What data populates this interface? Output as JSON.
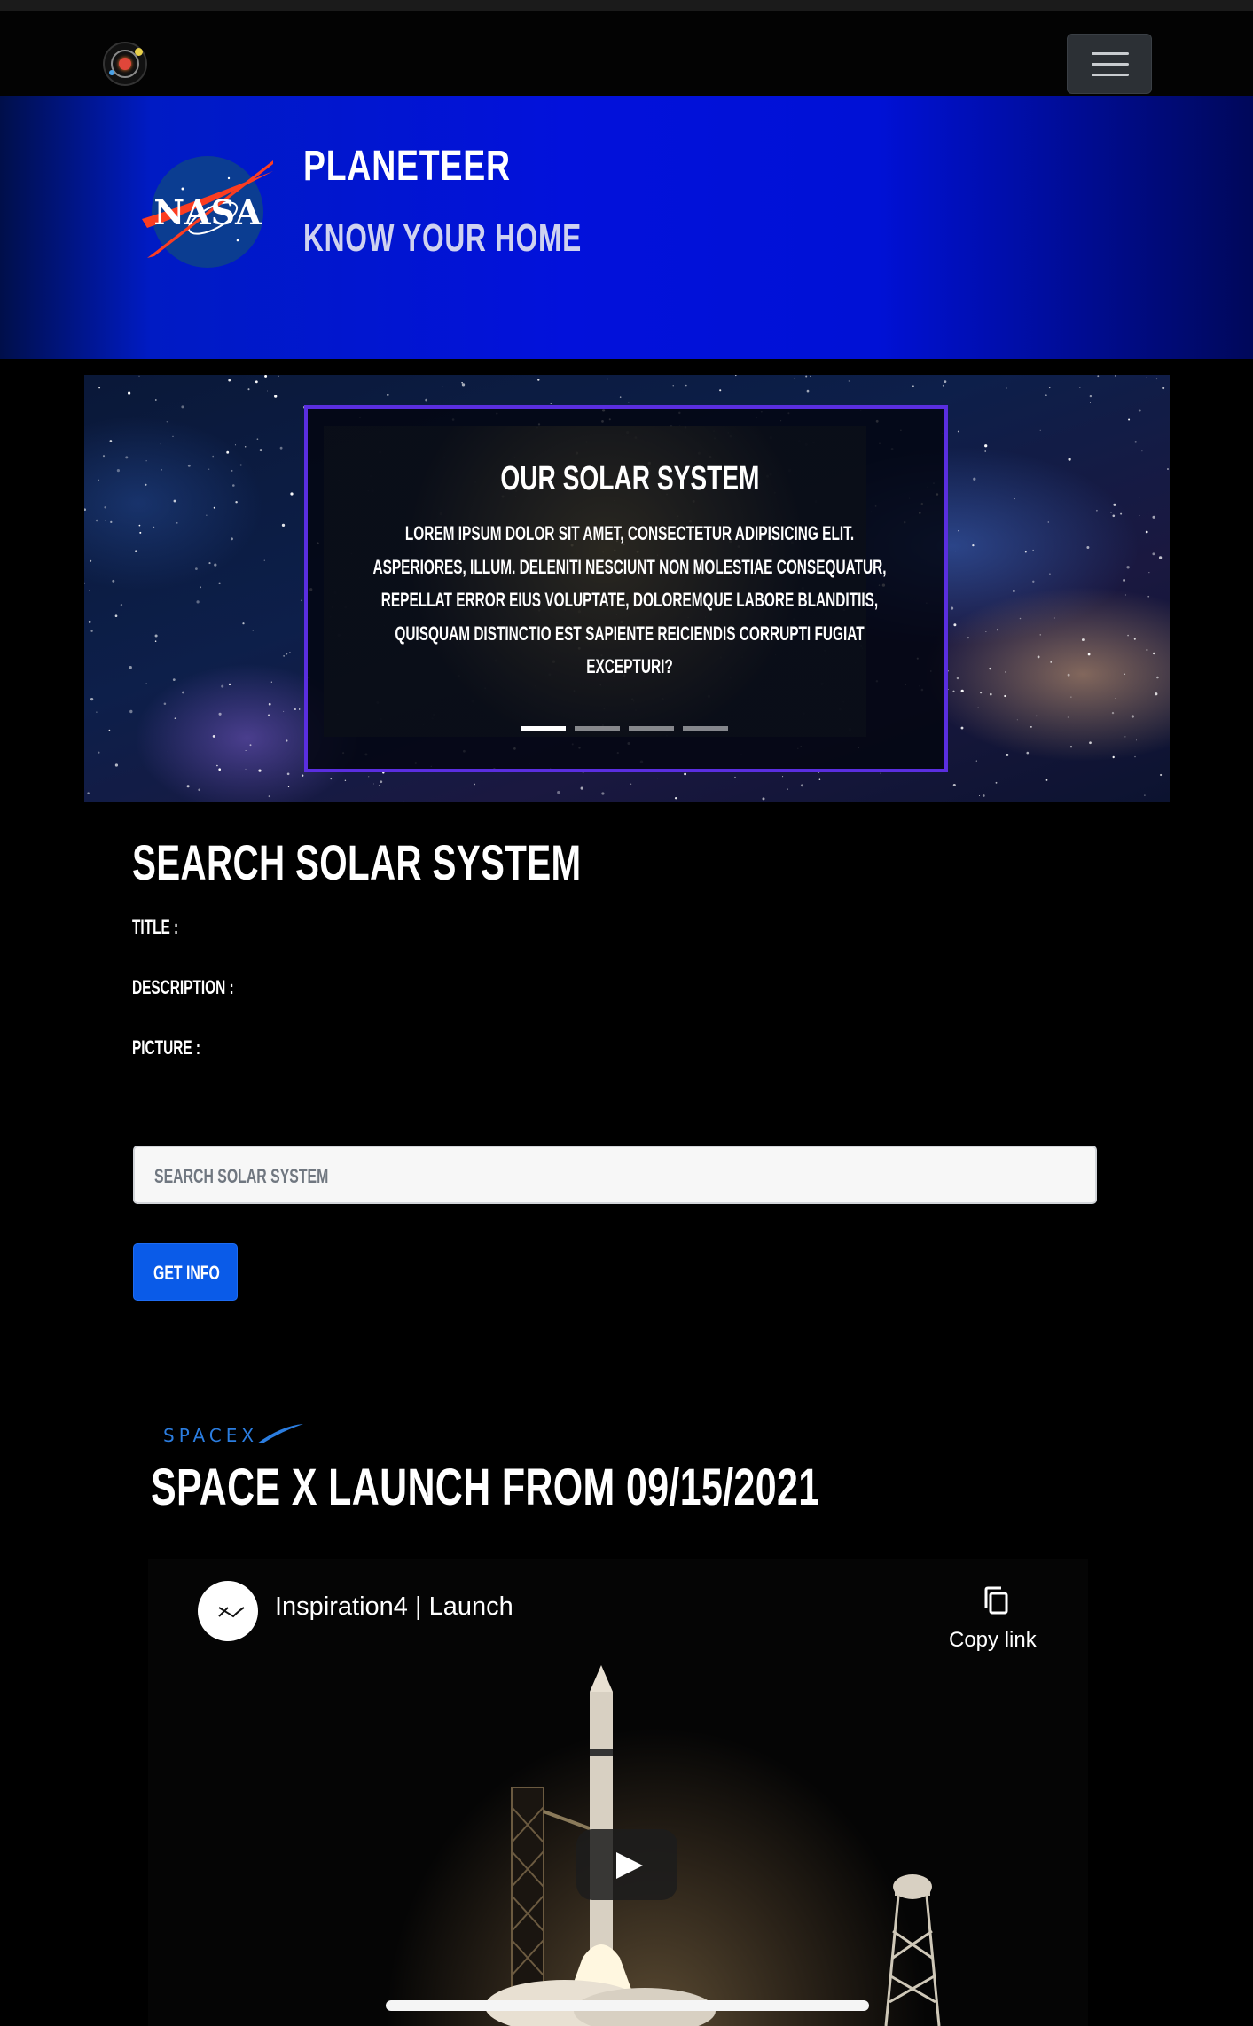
{
  "navbar": {
    "logo_icon": "solar-system-logo-icon",
    "menu_icon": "hamburger-menu-icon"
  },
  "hero": {
    "logo_text": "NASA",
    "title": "PLANETEER",
    "subtitle": "KNOW YOUR HOME",
    "background": "#0211db"
  },
  "carousel": {
    "caption_title": "OUR SOLAR SYSTEM",
    "caption_text": "LOREM IPSUM DOLOR SIT AMET, CONSECTETUR ADIPISICING ELIT. ASPERIORES, ILLUM. DELENITI NESCIUNT NON MOLESTIAE CONSEQUATUR, REPELLAT ERROR EIUS VOLUPTATE, DOLOREMQUE LABORE BLANDITIIS, QUISQUAM DISTINCTIO EST SAPIENTE REICIENDIS CORRUPTI FUGIAT EXCEPTURI?",
    "border_color": "#5a2ee0",
    "slides_count": 4,
    "active_slide": 1
  },
  "search": {
    "heading": "SEARCH SOLAR SYSTEM",
    "title_label": "TITLE :",
    "description_label": "DESCRIPTION :",
    "picture_label": "PICTURE :",
    "input_placeholder": "SEARCH SOLAR SYSTEM",
    "input_value": "",
    "button_label": "GET INFO",
    "button_color": "#0a5be8"
  },
  "spacex": {
    "logo_text": "SPACEX",
    "heading": "SPACE X LAUNCH FROM 09/15/2021"
  },
  "video": {
    "title": "Inspiration4 | Launch",
    "copy_label": "Copy link",
    "play_icon": "play-icon",
    "copy_icon": "copy-icon"
  }
}
